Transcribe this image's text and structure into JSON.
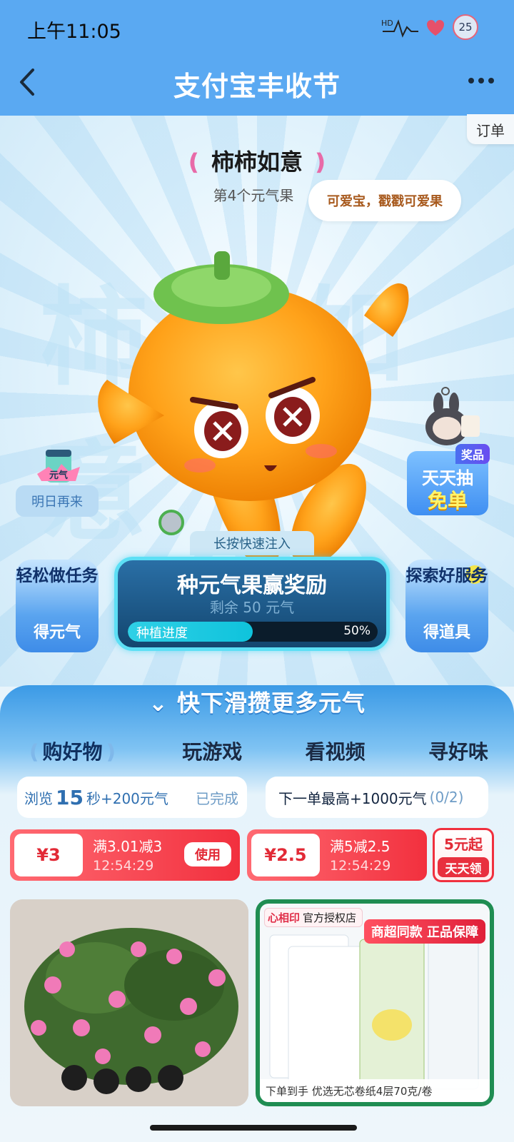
{
  "status_bar": {
    "time": "上午11:05",
    "battery": "25",
    "hr_label": "HD"
  },
  "header": {
    "title": "支付宝丰收节",
    "orders": "订单"
  },
  "hero": {
    "fruit_name": "柿柿如意",
    "fruit_sub": "第4个元气果",
    "bubble": "可爱宝，戳戳可爱果",
    "bg_word": "柿柿如意",
    "tomorrow_badge": "元气",
    "tomorrow_label": "明日再来",
    "lottery_badge": "奖品",
    "lottery_line1": "天天抽",
    "lottery_line2": "免单",
    "inject_tip": "长按快速注入",
    "left_card": {
      "title": "轻松做任务",
      "sub": "得元气"
    },
    "right_card": {
      "title": "探索好服务",
      "sub": "得道具"
    },
    "main_card": {
      "title": "种元气果赢奖励",
      "remain": "剩余 50 元气",
      "progress_label": "种植进度",
      "progress_value": "50%",
      "progress": 0.5
    }
  },
  "panel": {
    "title": "快下滑攒更多元气",
    "tabs": [
      "购好物",
      "玩游戏",
      "看视频",
      "寻好味"
    ],
    "task_left": {
      "prefix": "浏览",
      "num": "15",
      "suffix": "秒+200元气",
      "status": "已完成"
    },
    "task_right": {
      "text": "下一单最高+1000元气",
      "count": "(0/2)"
    },
    "coupons": [
      {
        "amount": "¥3",
        "cond": "满3.01减3",
        "timer": "12:54:29",
        "action": "使用"
      },
      {
        "amount": "¥2.5",
        "cond": "满5减2.5",
        "timer": "12:54:29"
      }
    ],
    "daily": {
      "top": "5元起",
      "bottom": "天天领"
    },
    "product2": {
      "badge_logo": "心相印",
      "badge_text": "官方授权店",
      "ribbon": "商超同款 正品保障",
      "foot": "下单到手 优选无芯卷纸4层70克/卷"
    }
  },
  "colors": {
    "header": "#5aa9f2",
    "accent": "#e22a36",
    "progress": "#2fd0e6"
  }
}
